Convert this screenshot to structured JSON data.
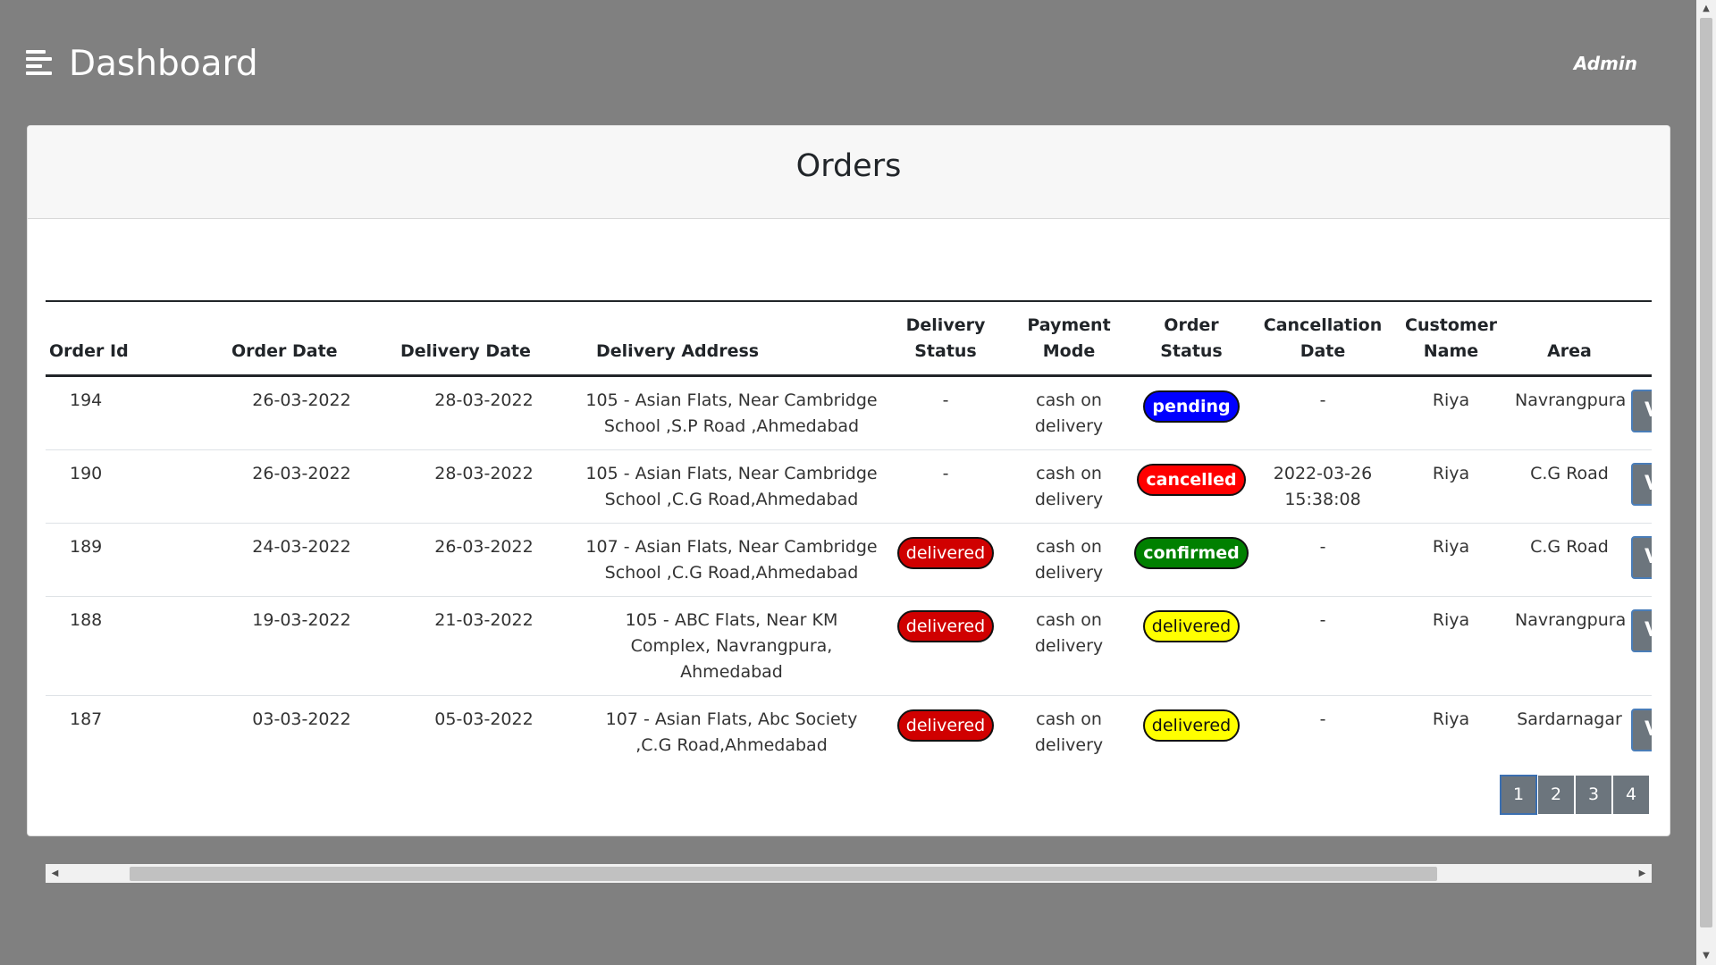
{
  "header": {
    "title": "Dashboard",
    "user_label": "Admin"
  },
  "card": {
    "title": "Orders"
  },
  "table": {
    "columns": [
      "Order Id",
      "Order Date",
      "Delivery Date",
      "Delivery Address",
      "Delivery Status",
      "Payment Mode",
      "Order Status",
      "Cancellation Date",
      "Customer Name",
      "Area"
    ],
    "rows": [
      {
        "order_id": "194",
        "order_date": "26-03-2022",
        "delivery_date": "28-03-2022",
        "address": "105 - Asian Flats, Near Cambridge School ,S.P Road ,Ahmedabad",
        "delivery_status": "-",
        "payment_mode": "cash on delivery",
        "order_status": "pending",
        "cancellation_date": "-",
        "customer": "Riya",
        "area": "Navrangpura",
        "action_label": "V"
      },
      {
        "order_id": "190",
        "order_date": "26-03-2022",
        "delivery_date": "28-03-2022",
        "address": "105 - Asian Flats, Near Cambridge School ,C.G Road,Ahmedabad",
        "delivery_status": "-",
        "payment_mode": "cash on delivery",
        "order_status": "cancelled",
        "cancellation_date": "2022-03-26 15:38:08",
        "customer": "Riya",
        "area": "C.G Road",
        "action_label": "V"
      },
      {
        "order_id": "189",
        "order_date": "24-03-2022",
        "delivery_date": "26-03-2022",
        "address": "107 - Asian Flats, Near Cambridge School ,C.G Road,Ahmedabad",
        "delivery_status": "delivered",
        "payment_mode": "cash on delivery",
        "order_status": "confirmed",
        "cancellation_date": "-",
        "customer": "Riya",
        "area": "C.G Road",
        "action_label": "V"
      },
      {
        "order_id": "188",
        "order_date": "19-03-2022",
        "delivery_date": "21-03-2022",
        "address": "105 - ABC Flats, Near KM Complex, Navrangpura, Ahmedabad",
        "delivery_status": "delivered",
        "payment_mode": "cash on delivery",
        "order_status": "delivered",
        "cancellation_date": "-",
        "customer": "Riya",
        "area": "Navrangpura",
        "action_label": "V"
      },
      {
        "order_id": "187",
        "order_date": "03-03-2022",
        "delivery_date": "05-03-2022",
        "address": "107 - Asian Flats, Abc Society ,C.G Road,Ahmedabad",
        "delivery_status": "delivered",
        "payment_mode": "cash on delivery",
        "order_status": "delivered",
        "cancellation_date": "-",
        "customer": "Riya",
        "area": "Sardarnagar",
        "action_label": "V"
      }
    ]
  },
  "status_colors": {
    "pending": "#0000ff",
    "cancelled": "#ff0000",
    "confirmed": "#008000",
    "delivered_delivery": "#d00000",
    "delivered_order": "#ffff00"
  },
  "pagination": {
    "pages": [
      "1",
      "2",
      "3",
      "4"
    ],
    "current": "1"
  },
  "icons": {
    "menu": "hamburger-menu-icon",
    "scroll_left": "chevron-left-icon",
    "scroll_right": "chevron-right-icon",
    "scroll_up": "chevron-up-icon",
    "scroll_down": "chevron-down-icon"
  }
}
